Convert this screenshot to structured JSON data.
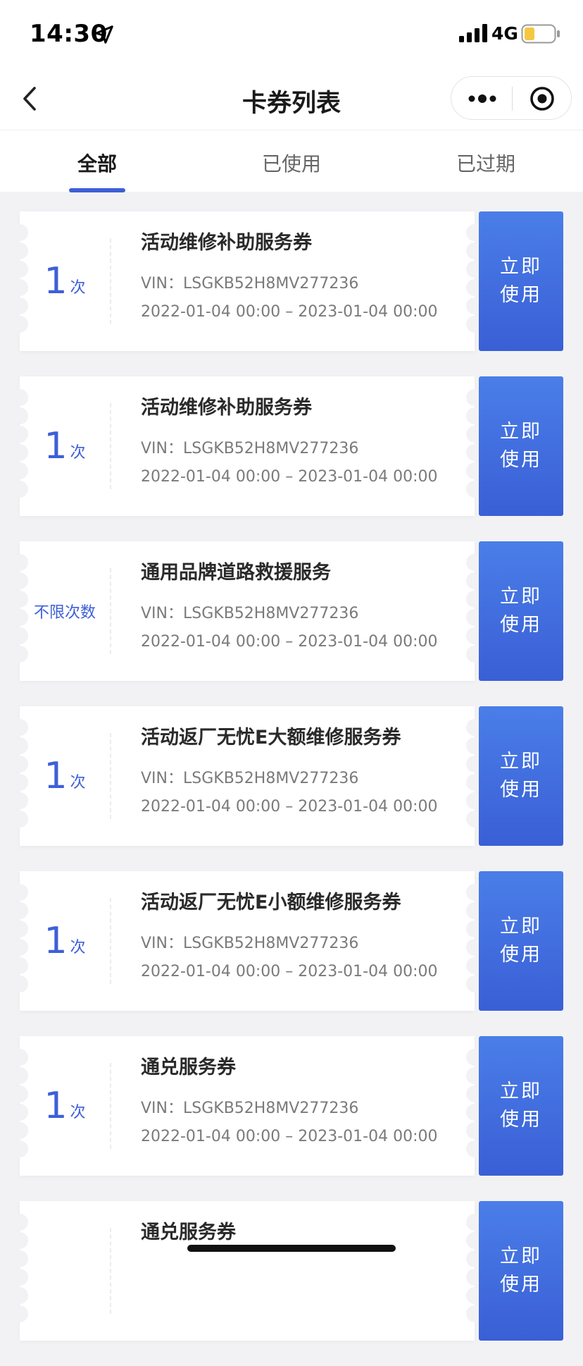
{
  "status_bar": {
    "time": "14:30",
    "network": "4G"
  },
  "nav": {
    "title": "卡券列表"
  },
  "tabs": [
    {
      "label": "全部",
      "active": true
    },
    {
      "label": "已使用",
      "active": false
    },
    {
      "label": "已过期",
      "active": false
    }
  ],
  "coupons": [
    {
      "count": "1",
      "unit": "次",
      "title": "活动维修补助服务券",
      "vin": "VIN：LSGKB52H8MV277236",
      "date": "2022-01-04 00:00 – 2023-01-04 00:00",
      "button": "立即使用"
    },
    {
      "count": "1",
      "unit": "次",
      "title": "活动维修补助服务券",
      "vin": "VIN：LSGKB52H8MV277236",
      "date": "2022-01-04 00:00 – 2023-01-04 00:00",
      "button": "立即使用"
    },
    {
      "count_text": "不限次数",
      "title": "通用品牌道路救援服务",
      "vin": "VIN：LSGKB52H8MV277236",
      "date": "2022-01-04 00:00 – 2023-01-04 00:00",
      "button": "立即使用"
    },
    {
      "count": "1",
      "unit": "次",
      "title": "活动返厂无忧E大额维修服务券",
      "vin": "VIN：LSGKB52H8MV277236",
      "date": "2022-01-04 00:00 – 2023-01-04 00:00",
      "button": "立即使用"
    },
    {
      "count": "1",
      "unit": "次",
      "title": "活动返厂无忧E小额维修服务券",
      "vin": "VIN：LSGKB52H8MV277236",
      "date": "2022-01-04 00:00 – 2023-01-04 00:00",
      "button": "立即使用"
    },
    {
      "count": "1",
      "unit": "次",
      "title": "通兑服务券",
      "vin": "VIN：LSGKB52H8MV277236",
      "date": "2022-01-04 00:00 – 2023-01-04 00:00",
      "button": "立即使用"
    },
    {
      "title": "通兑服务券",
      "button": "立即使用"
    }
  ],
  "colors": {
    "accent": "#3d5fd8",
    "button_gradient_top": "#4a7ee8",
    "button_gradient_bottom": "#3a5fd6",
    "background": "#f2f2f5"
  },
  "icons": {
    "back": "chevron-left-icon",
    "more": "more-dots-icon",
    "close": "target-circle-icon",
    "location": "location-arrow-icon",
    "signal": "cellular-signal-icon",
    "battery": "battery-icon"
  }
}
